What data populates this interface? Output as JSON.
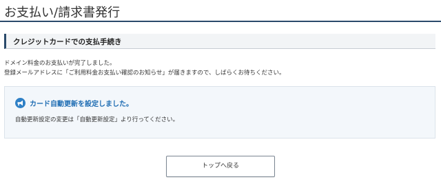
{
  "page": {
    "title": "お支払い/請求書発行"
  },
  "section": {
    "heading": "クレジットカードでの支払手続き"
  },
  "message": {
    "line1": "ドメイン料金のお支払いが完了しました。",
    "line2": "登録メールアドレスに「ご利用料金お支払い確認のお知らせ」が届きますので、しばらくお待ちください。"
  },
  "notice": {
    "icon": "megaphone-icon",
    "title": "カード自動更新を設定しました。",
    "text": "自動更新設定の変更は「自動更新設定」より行ってください。"
  },
  "actions": {
    "back_to_top_label": "トップへ戻る"
  },
  "colors": {
    "accent": "#2a4a6b",
    "notice_blue": "#1f6db3",
    "notice_bg": "#f3f7fb"
  }
}
